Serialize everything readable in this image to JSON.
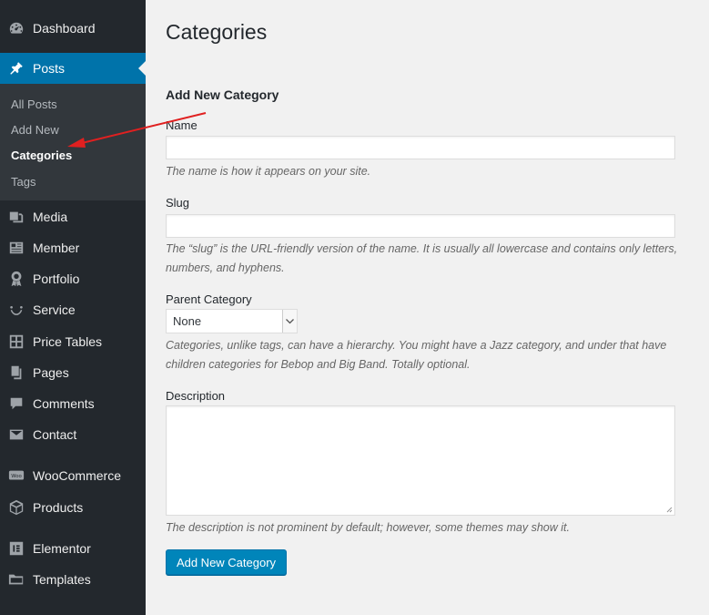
{
  "sidebar": {
    "items": [
      {
        "label": "Dashboard",
        "icon": "dashboard-icon"
      },
      {
        "label": "Posts",
        "icon": "pushpin-icon",
        "active": true
      },
      {
        "label": "Media",
        "icon": "media-icon"
      },
      {
        "label": "Member",
        "icon": "id-card-icon"
      },
      {
        "label": "Portfolio",
        "icon": "award-icon"
      },
      {
        "label": "Service",
        "icon": "smiley-icon"
      },
      {
        "label": "Price Tables",
        "icon": "grid-icon"
      },
      {
        "label": "Pages",
        "icon": "pages-icon"
      },
      {
        "label": "Comments",
        "icon": "comment-icon"
      },
      {
        "label": "Contact",
        "icon": "envelope-icon"
      },
      {
        "label": "WooCommerce",
        "icon": "woo-icon"
      },
      {
        "label": "Products",
        "icon": "box-icon"
      },
      {
        "label": "Elementor",
        "icon": "elementor-icon"
      },
      {
        "label": "Templates",
        "icon": "folder-icon"
      }
    ],
    "submenu": [
      {
        "label": "All Posts"
      },
      {
        "label": "Add New"
      },
      {
        "label": "Categories",
        "current": true
      },
      {
        "label": "Tags"
      }
    ]
  },
  "main": {
    "title": "Categories",
    "form_heading": "Add New Category",
    "name": {
      "label": "Name",
      "value": "",
      "help": "The name is how it appears on your site."
    },
    "slug": {
      "label": "Slug",
      "value": "",
      "help": "The “slug” is the URL-friendly version of the name. It is usually all lowercase and contains only letters, numbers, and hyphens."
    },
    "parent": {
      "label": "Parent Category",
      "value": "None",
      "help": "Categories, unlike tags, can have a hierarchy. You might have a Jazz category, and under that have children categories for Bebop and Big Band. Totally optional."
    },
    "description": {
      "label": "Description",
      "value": "",
      "help": "The description is not prominent by default; however, some themes may show it."
    },
    "submit_label": "Add New Category"
  },
  "colors": {
    "sidebar_bg": "#23282d",
    "submenu_bg": "#32373c",
    "active_bg": "#0073aa",
    "button_bg": "#0085ba",
    "annotation_arrow": "#e02020"
  }
}
